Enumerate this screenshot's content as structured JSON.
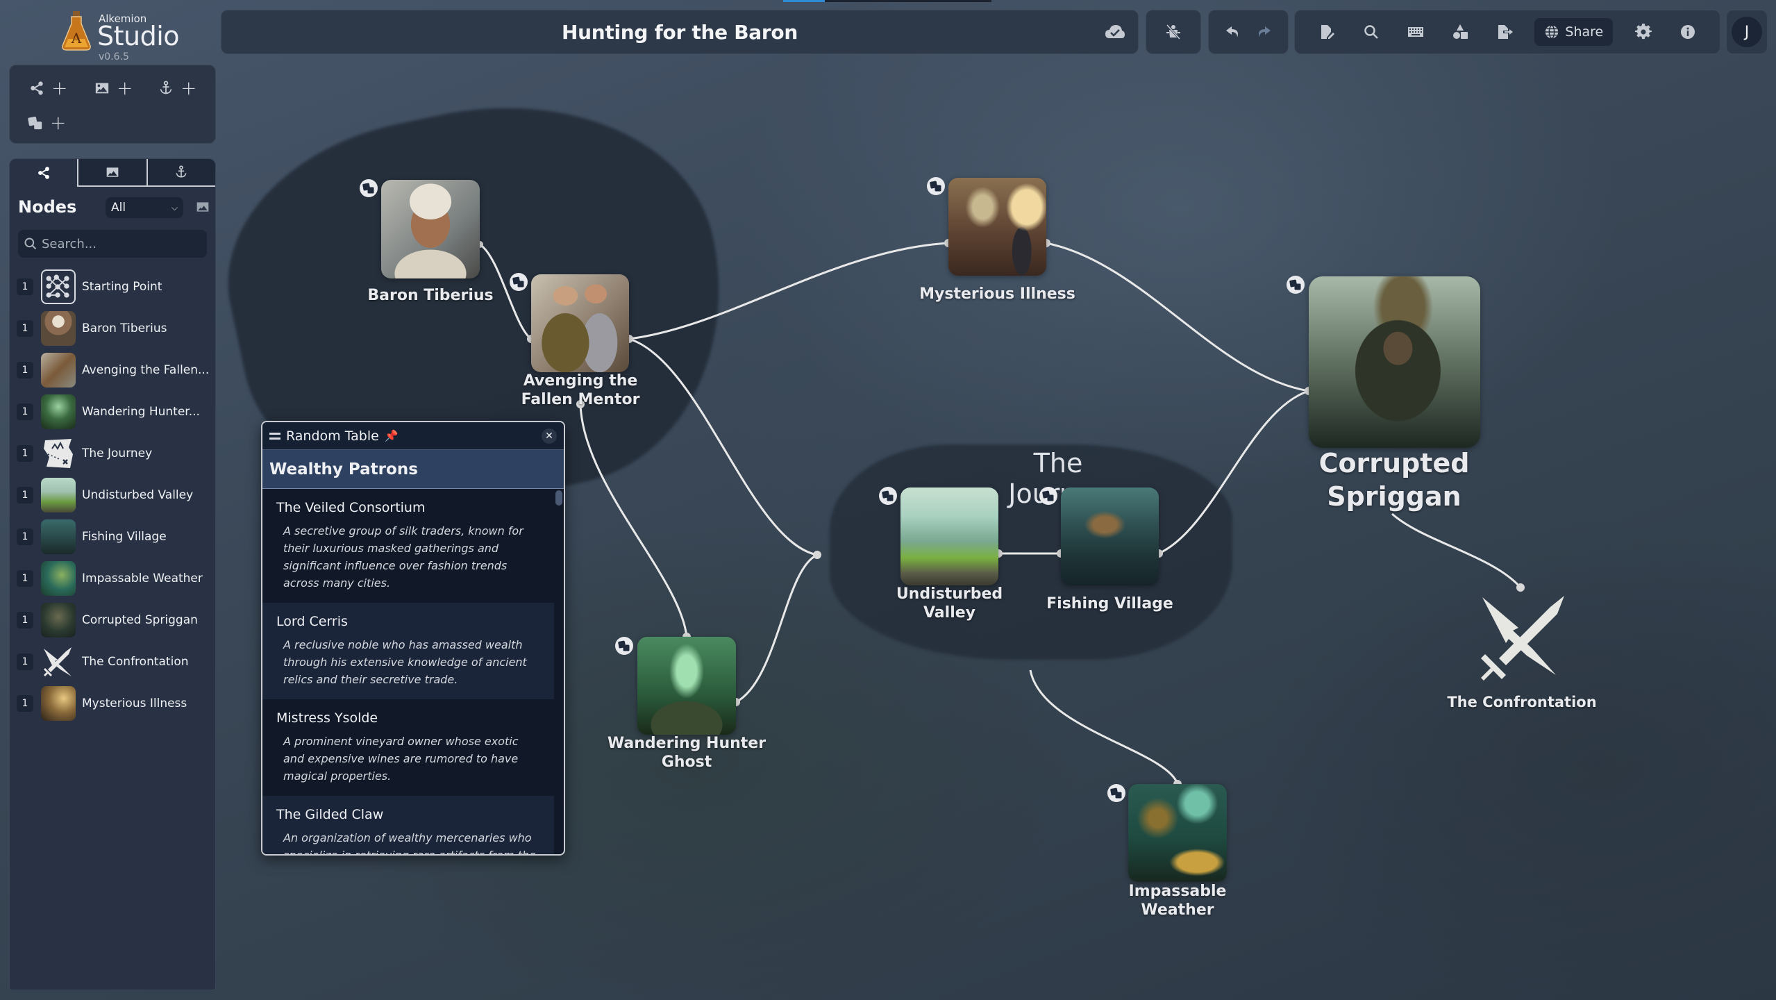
{
  "app": {
    "logo_small": "Alkemion",
    "logo_big": "Studio",
    "version": "v0.6.5"
  },
  "header": {
    "title": "Hunting for the Baron",
    "save_status_icon": "cloud-check-icon",
    "share_label": "Share",
    "avatar_initial": "J"
  },
  "toolbox": {
    "buttons": [
      {
        "icon": "share-nodes-icon",
        "label": "+"
      },
      {
        "icon": "image-icon",
        "label": "+"
      },
      {
        "icon": "anchor-icon",
        "label": "+"
      },
      {
        "icon": "dice-icon",
        "label": "+"
      }
    ]
  },
  "sidebar": {
    "tabs": [
      "nodes",
      "images",
      "anchors"
    ],
    "nodes_title": "Nodes",
    "filter_value": "All",
    "search_placeholder": "Search...",
    "items": [
      {
        "count": "1",
        "name": "Starting Point",
        "thumb": "graph-icon"
      },
      {
        "count": "1",
        "name": "Baron Tiberius",
        "thumb": "portrait"
      },
      {
        "count": "1",
        "name": "Avenging the Fallen...",
        "thumb": "portrait"
      },
      {
        "count": "1",
        "name": "Wandering Hunter...",
        "thumb": "forest"
      },
      {
        "count": "1",
        "name": "The Journey",
        "thumb": "map-icon"
      },
      {
        "count": "1",
        "name": "Undisturbed Valley",
        "thumb": "valley"
      },
      {
        "count": "1",
        "name": "Fishing Village",
        "thumb": "village"
      },
      {
        "count": "1",
        "name": "Impassable Weather",
        "thumb": "storm"
      },
      {
        "count": "1",
        "name": "Corrupted Spriggan",
        "thumb": "spriggan"
      },
      {
        "count": "1",
        "name": "The Confrontation",
        "thumb": "crossed-swords-icon"
      },
      {
        "count": "1",
        "name": "Mysterious Illness",
        "thumb": "illness"
      }
    ]
  },
  "graph": {
    "group_title": "The Journey",
    "nodes": {
      "baron": "Baron Tiberius",
      "avenging": "Avenging the Fallen Mentor",
      "illness": "Mysterious Illness",
      "spriggan": "Corrupted Spriggan",
      "valley": "Undisturbed Valley",
      "village": "Fishing Village",
      "ghost": "Wandering Hunter Ghost",
      "weather": "Impassable Weather",
      "confrontation": "The Confrontation"
    }
  },
  "random_table": {
    "panel_title": "Random Table",
    "table_name": "Wealthy Patrons",
    "entries": [
      {
        "title": "The Veiled Consortium",
        "desc": "A secretive group of silk traders, known for their luxurious masked gatherings and significant influence over fashion trends across many cities."
      },
      {
        "title": "Lord Cerris",
        "desc": "A reclusive noble who has amassed wealth through his extensive knowledge of ancient relics and their secretive trade."
      },
      {
        "title": "Mistress Ysolde",
        "desc": "A prominent vineyard owner whose exotic and expensive wines are rumored to have magical properties."
      },
      {
        "title": "The Gilded Claw",
        "desc": "An organization of wealthy mercenaries who specialize in retrieving rare artifacts from the most"
      }
    ]
  },
  "colors": {
    "accent": "#2f8bd6",
    "panel": "#283244",
    "header": "#2d3849",
    "table_header": "#2f4160"
  }
}
